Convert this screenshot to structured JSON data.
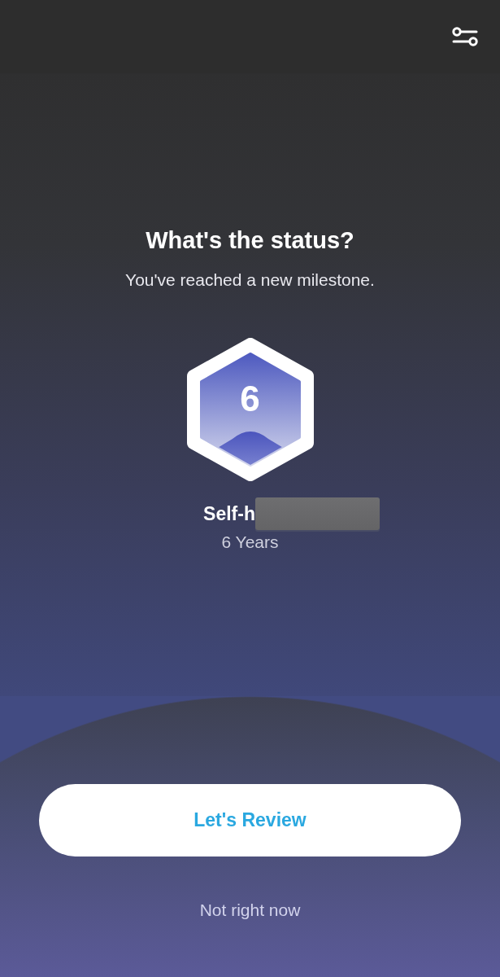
{
  "prompt": {
    "title": "What's the status?",
    "subtitle": "You've reached a new milestone."
  },
  "milestone": {
    "badge_number": "6",
    "name": "Self-h",
    "redacted": true,
    "duration": "6 Years"
  },
  "actions": {
    "primary": "Let's Review",
    "secondary": "Not right now"
  }
}
